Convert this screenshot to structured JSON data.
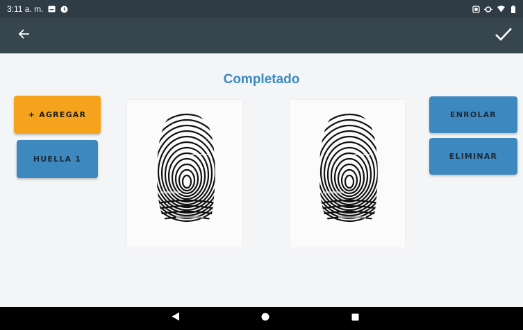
{
  "status_bar": {
    "time": "3:11 a. m.",
    "left_icons": [
      "notification-card-icon",
      "clock-icon"
    ],
    "right_icons": [
      "cast-icon",
      "sync-icon",
      "wifi-icon",
      "battery-icon"
    ]
  },
  "toolbar": {
    "back_icon": "arrow-left-icon",
    "confirm_icon": "checkmark-icon"
  },
  "main": {
    "title": "Completado",
    "left_buttons": {
      "add_label": "+ AGREGAR",
      "finger_label": "HUELLA 1"
    },
    "right_buttons": {
      "enroll_label": "ENROLAR",
      "delete_label": "ELIMINAR"
    }
  },
  "nav_bar": {
    "icons": [
      "back-triangle-icon",
      "home-circle-icon",
      "recents-square-icon"
    ]
  },
  "colors": {
    "status_bar": "#2f3b45",
    "toolbar": "#37454f",
    "title": "#3b8ac2",
    "orange_button": "#f5a31c",
    "blue_button": "#3e88c0",
    "background": "#f4f5f6"
  }
}
